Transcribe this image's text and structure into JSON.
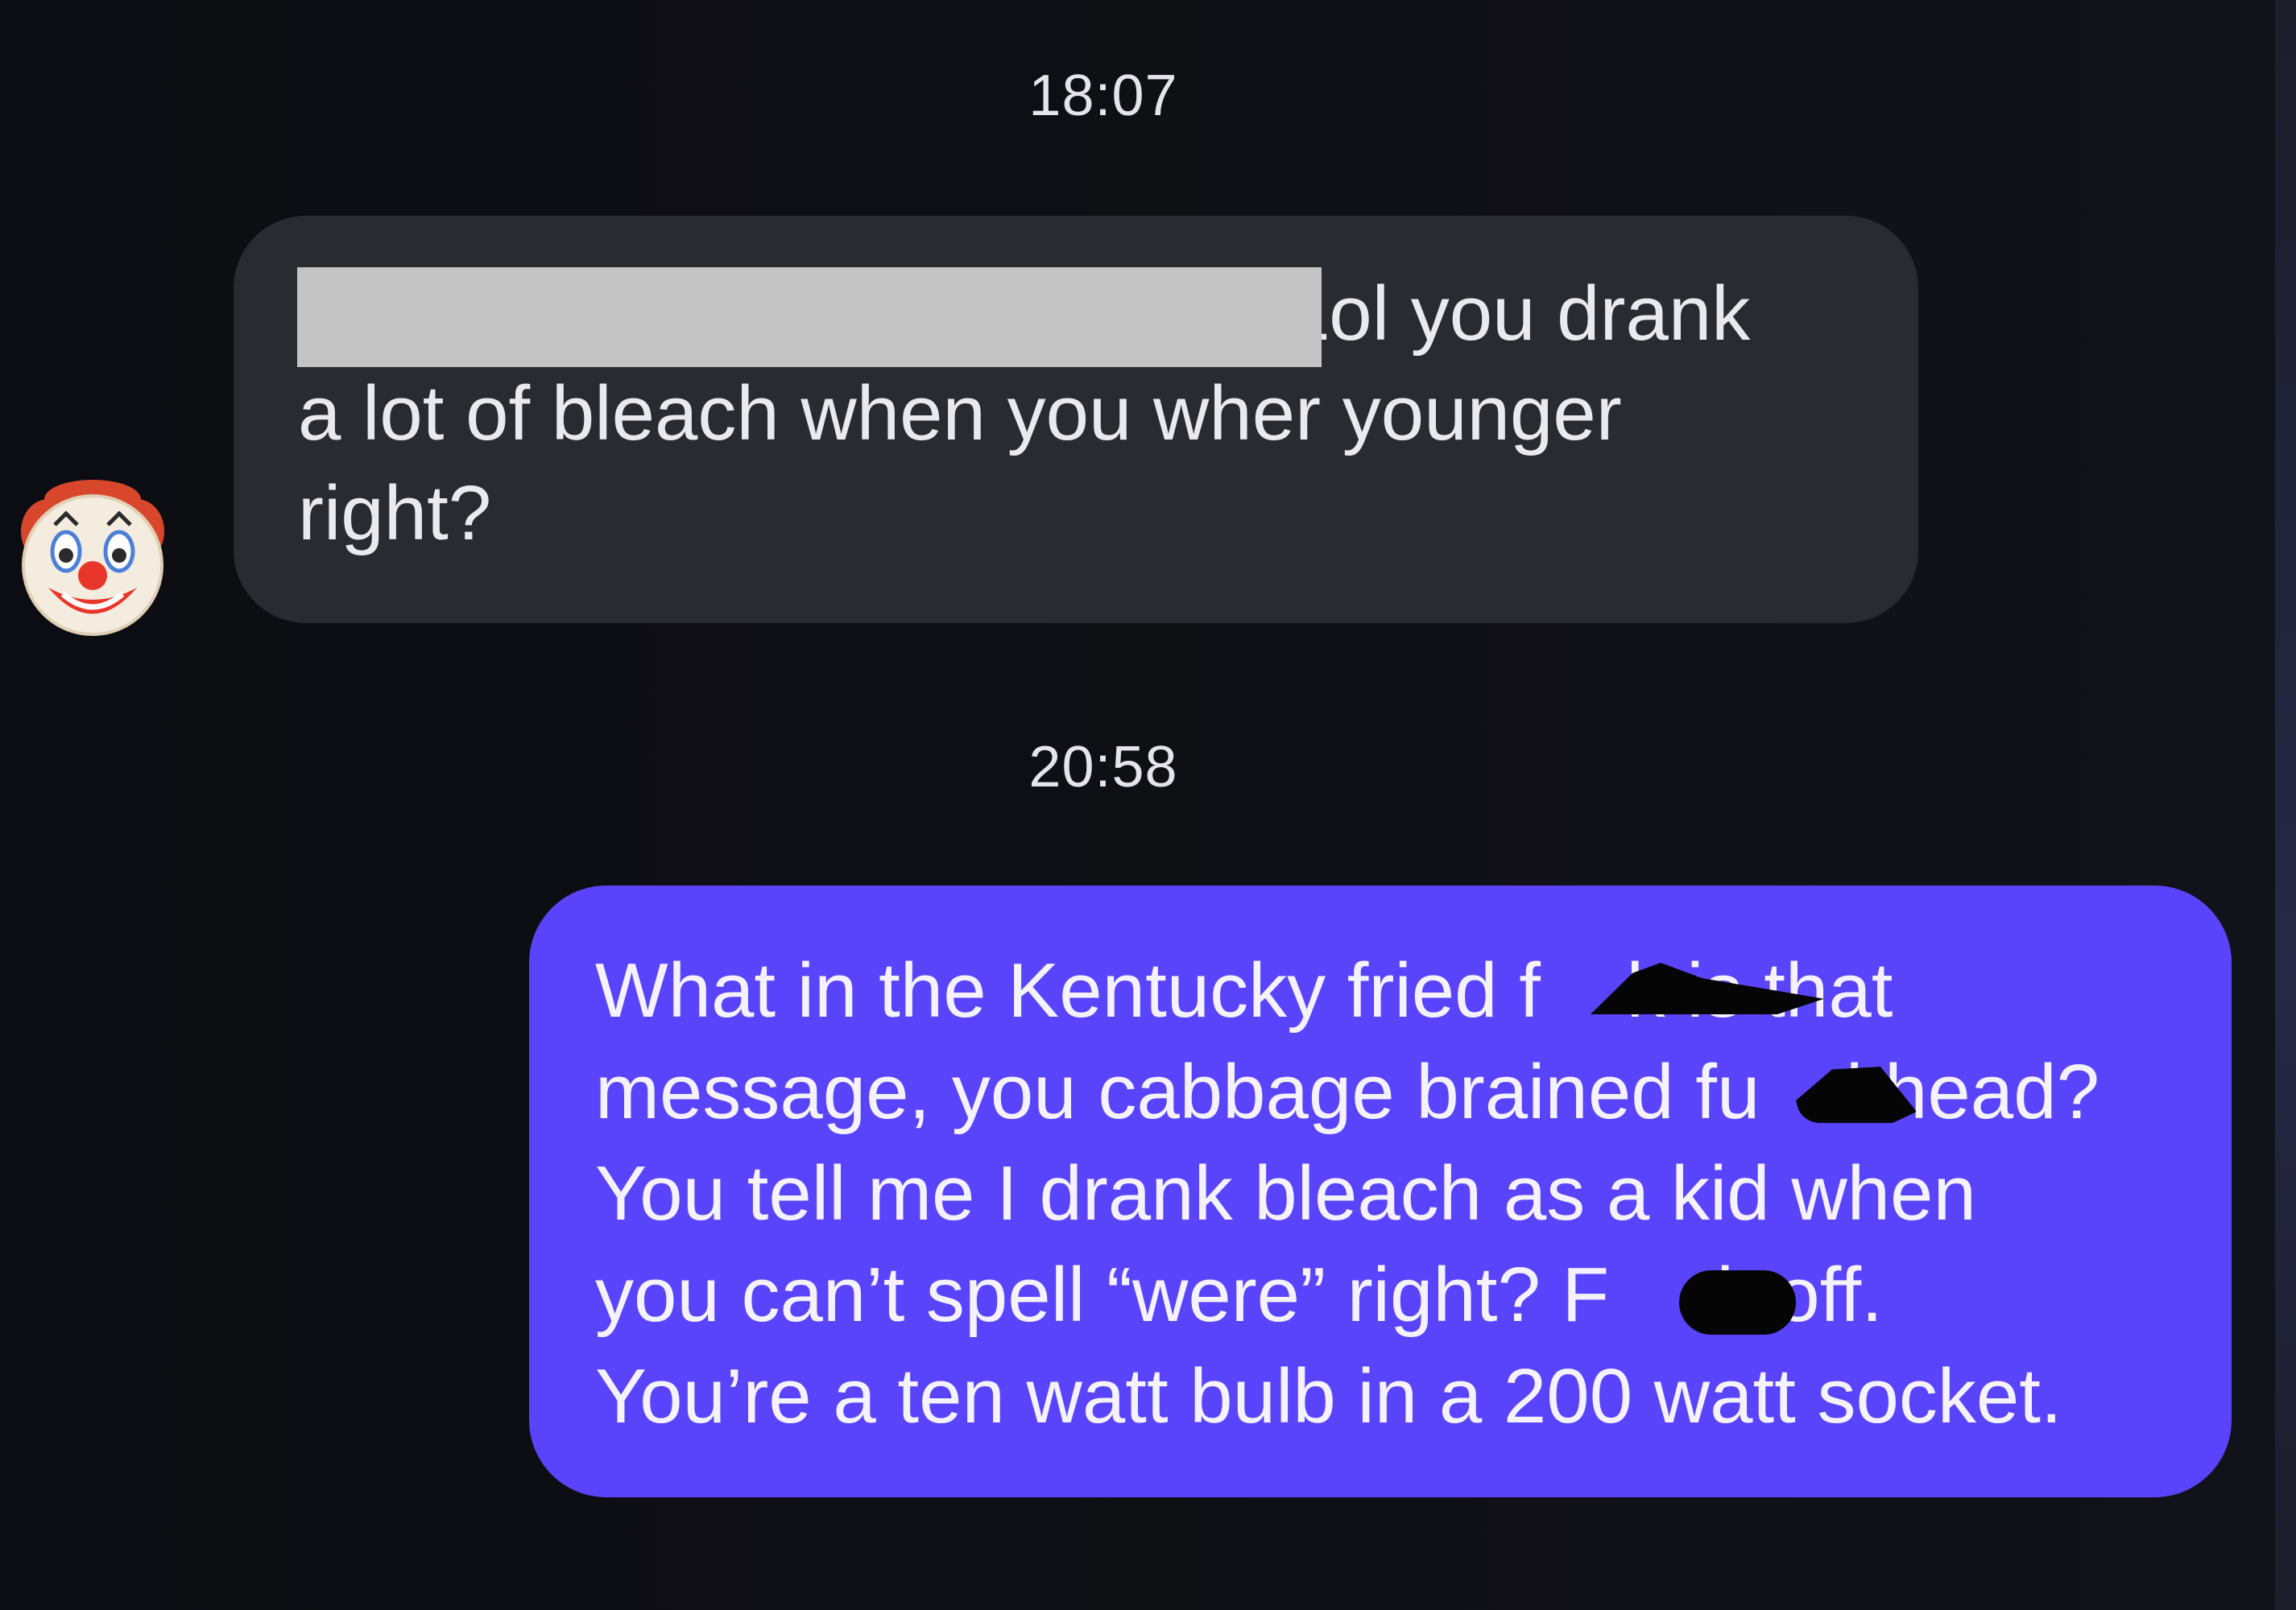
{
  "conversation": {
    "timestamps": [
      "18:07",
      "20:58"
    ],
    "incoming_message": {
      "text": "                                              Lol you drank\na lot of bleach when you wher younger\nright?",
      "redacted": true
    },
    "sender_avatar_icon": "clown-face-emoji-icon",
    "outgoing_message": {
      "text": "What in the Kentucky fried f    k is that\nmessage, you cabbage brained fu    khead?\nYou tell me I drank bleach as a kid when\nyou can’t spell “were” right? F     k off.\nYou’re a ten watt bulb in a 200 watt socket."
    }
  },
  "colors": {
    "background": "#0d0e13",
    "incoming_bubble": "#2a2b30",
    "outgoing_bubble": "#5a44fb",
    "redaction": "#c4c4c4"
  }
}
